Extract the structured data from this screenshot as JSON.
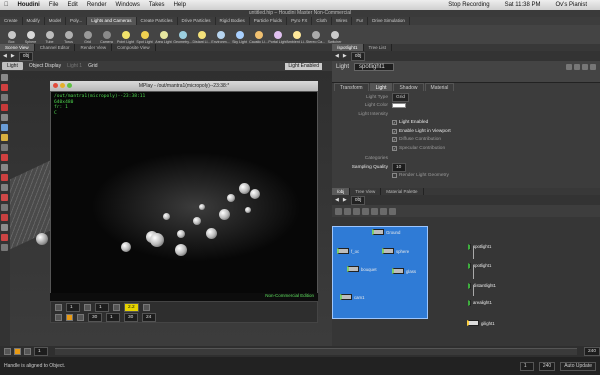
{
  "menubar": {
    "app": "Houdini",
    "items": [
      "File",
      "Edit",
      "Render",
      "Windows",
      "Takes",
      "Help"
    ],
    "recording": "Stop Recording",
    "clock": "Sat 11:38 PM",
    "user": "Ov's Pianist"
  },
  "window_title": "untitled.hip – Houdini Master Non-Commercial",
  "shelf_tabs": [
    "Create",
    "Modify",
    "Model",
    "Poly...",
    "Lights and Cameras",
    "Create Particles",
    "Drive Particles",
    "Rigid Bodies",
    "Particle Fluids",
    "Pyro FX",
    "Cloth",
    "Wires",
    "Fur",
    "Drive Simulation"
  ],
  "shelf_tools": [
    {
      "label": "Box",
      "color": "#c8c8c8"
    },
    {
      "label": "Sphere",
      "color": "#d9d9d9"
    },
    {
      "label": "Tube",
      "color": "#bdbdbd"
    },
    {
      "label": "Torus",
      "color": "#b0b0b0"
    },
    {
      "label": "Grid",
      "color": "#999999"
    },
    {
      "label": "Camera",
      "color": "#8a8a8a"
    },
    {
      "label": "Point Light",
      "color": "#f0e16a"
    },
    {
      "label": "Spot Light",
      "color": "#f0d050"
    },
    {
      "label": "Area Light",
      "color": "#e8e8a0"
    },
    {
      "label": "Geometry...",
      "color": "#9ccfe0"
    },
    {
      "label": "Distant Li...",
      "color": "#f5e27a"
    },
    {
      "label": "Environm...",
      "color": "#b7d5f0"
    },
    {
      "label": "Sky Light",
      "color": "#a8d0ff"
    },
    {
      "label": "Caustic Li...",
      "color": "#f0c070"
    },
    {
      "label": "Portal Light",
      "color": "#e0c0f0"
    },
    {
      "label": "Ambient Li...",
      "color": "#ffe89a"
    },
    {
      "label": "Stereo Ca...",
      "color": "#aaaaaa"
    },
    {
      "label": "Switcher",
      "color": "#cccccc"
    }
  ],
  "left_tabs": [
    "Scene View",
    "Channel Editor",
    "Render View",
    "Composite View"
  ],
  "left_path": "obj",
  "viewport_header": {
    "light_label": "Light",
    "display": "Object Display",
    "light2": "Light 1",
    "grid": "Grid",
    "enabled": "Light Enabled"
  },
  "mplay": {
    "title": "MPlay - /out/mantra1(micropoly)--23:38:*",
    "info": [
      "/out/mantra1(micropoly)--23:38:11",
      "640x480",
      "fr: 1",
      "C"
    ],
    "footer": "Non-Commercial Edition",
    "frame": "1",
    "gamma": "2.2",
    "start": "1",
    "end": "30",
    "fps": "24",
    "step": "1",
    "cur": "30"
  },
  "timeline": {
    "start": "1",
    "end": "240",
    "ticks": [
      "1",
      "24",
      "48",
      "72",
      "96",
      "120",
      "144",
      "168",
      "192",
      "216",
      "240"
    ],
    "frame_a": "1",
    "frame_b": "1"
  },
  "status": {
    "message": "Handle is aligned to Object.",
    "auto_update": "Auto Update"
  },
  "right_tabs": [
    "/spotlight1",
    "Tree List"
  ],
  "right_path": "obj",
  "node_header": {
    "type": "Light",
    "name": "spotlight1"
  },
  "param_tabs": [
    "Transform",
    "Light",
    "Shadow",
    "Material"
  ],
  "params": {
    "light_type": {
      "label": "Light Type",
      "value": "Grid"
    },
    "light_color": {
      "label": "Light Color"
    },
    "light_intensity": {
      "label": "Light Intensity"
    },
    "checks": [
      {
        "label": "Light Enabled",
        "on": true
      },
      {
        "label": "Enable Light in Viewport",
        "on": true
      },
      {
        "label": "Diffuse Contribution",
        "on": true
      },
      {
        "label": "Specular Contribution",
        "on": true
      }
    ],
    "categories": {
      "label": "Categories"
    },
    "sampling": {
      "label": "Sampling Quality",
      "value": "10"
    },
    "geometry": {
      "label": "Render Light Geometry"
    }
  },
  "net_tabs": [
    "/obj",
    "Tree View",
    "Material Palette"
  ],
  "net_path": "obj",
  "nodes": [
    {
      "label": "Ground",
      "kind": "geo"
    },
    {
      "label": "f_oc",
      "kind": "geo"
    },
    {
      "label": "sphere",
      "kind": "geo"
    },
    {
      "label": "bouquet",
      "kind": "geo"
    },
    {
      "label": "glass",
      "kind": "geo"
    },
    {
      "label": "cam1",
      "kind": "geo"
    },
    {
      "label": "spotlight1",
      "kind": "light"
    },
    {
      "label": "spotlight1",
      "kind": "light"
    },
    {
      "label": "distantlight1",
      "kind": "light"
    },
    {
      "label": "arealight1",
      "kind": "light"
    },
    {
      "label": "gilight1",
      "kind": "sel"
    }
  ]
}
